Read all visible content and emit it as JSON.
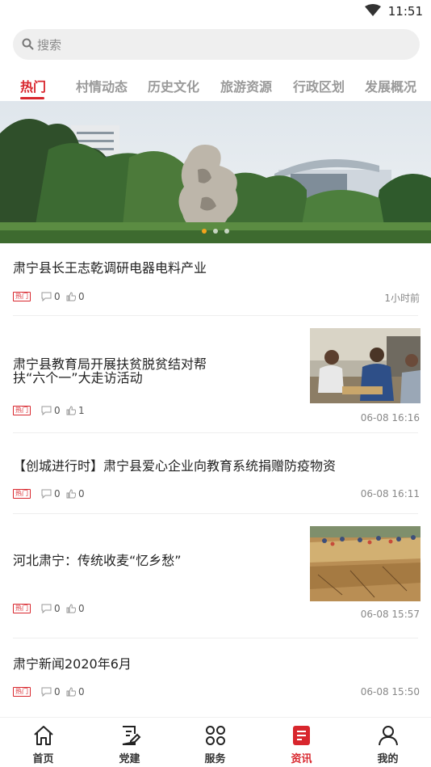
{
  "status_bar": {
    "time": "11:51"
  },
  "search": {
    "placeholder": "搜索"
  },
  "tabs": [
    {
      "label": "热门",
      "active": true
    },
    {
      "label": "村情动态"
    },
    {
      "label": "历史文化"
    },
    {
      "label": "旅游资源"
    },
    {
      "label": "行政区划"
    },
    {
      "label": "发展概况"
    }
  ],
  "banner": {
    "slide_count": 3,
    "active_slide": 1
  },
  "news": [
    {
      "title": "肃宁县长王志乾调研电器电料产业",
      "tag": "热门",
      "comments": "0",
      "likes": "0",
      "time": "1小时前",
      "has_image": false
    },
    {
      "title_line1": "肃宁县教育局开展扶贫脱贫结对帮",
      "title_line2": "扶“六个一”大走访活动",
      "tag": "热门",
      "comments": "0",
      "likes": "1",
      "time": "06-08 16:16",
      "has_image": true
    },
    {
      "title": "【创城进行时】肃宁县爱心企业向教育系统捐赠防疫物资",
      "tag": "热门",
      "comments": "0",
      "likes": "0",
      "time": "06-08 16:11",
      "has_image": false
    },
    {
      "title": "河北肃宁：传统收麦“忆乡愁”",
      "tag": "热门",
      "comments": "0",
      "likes": "0",
      "time": "06-08 15:57",
      "has_image": true
    },
    {
      "title": "肃宁新闻2020年6月",
      "tag": "热门",
      "comments": "0",
      "likes": "0",
      "time": "06-08 15:50",
      "has_image": false
    }
  ],
  "bottom_nav": [
    {
      "label": "首页",
      "icon": "home-icon"
    },
    {
      "label": "党建",
      "icon": "document-edit-icon"
    },
    {
      "label": "服务",
      "icon": "grid-icon"
    },
    {
      "label": "资讯",
      "icon": "news-icon",
      "active": true
    },
    {
      "label": "我的",
      "icon": "user-icon"
    }
  ],
  "colors": {
    "accent": "#d8262d",
    "tag_border": "#d8262d",
    "dot_active": "#f2a31c"
  }
}
